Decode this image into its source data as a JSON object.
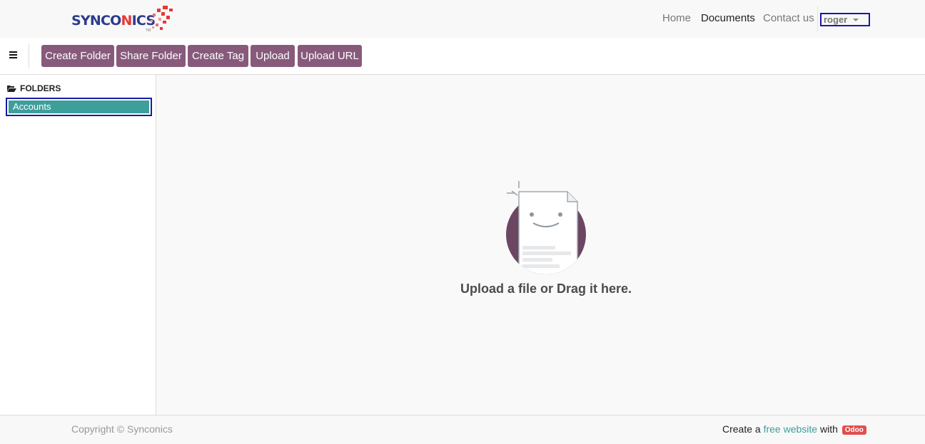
{
  "brand": {
    "name_part1": "SYNCO",
    "name_part2": "N",
    "name_part3": "ICS",
    "tm": "TM",
    "colors": {
      "primary": "#2d3b8f",
      "accent": "#e53935"
    }
  },
  "nav": {
    "items": [
      {
        "label": "Home",
        "active": false
      },
      {
        "label": "Documents",
        "active": true
      },
      {
        "label": "Contact us",
        "active": false
      }
    ],
    "user": "roger"
  },
  "toolbar": {
    "menu_icon": "hamburger-icon",
    "buttons": [
      {
        "label": "Create Folder"
      },
      {
        "label": "Share Folder"
      },
      {
        "label": "Create Tag"
      },
      {
        "label": "Upload"
      },
      {
        "label": "Upload URL"
      }
    ],
    "button_color": "#875a7b"
  },
  "sidebar": {
    "heading_icon": "folder-open-icon",
    "heading": "FOLDERS",
    "folders": [
      {
        "label": "Accounts",
        "selected": true
      }
    ],
    "selected_color": "#3d9e9a"
  },
  "main": {
    "empty_icon": "smiling-document-icon",
    "empty_message": "Upload a file or Drag it here."
  },
  "footer": {
    "copyright": "Copyright © Synconics",
    "powered_prefix": "Create a ",
    "powered_link": "free website",
    "powered_mid": " with ",
    "powered_badge": "Odoo"
  }
}
